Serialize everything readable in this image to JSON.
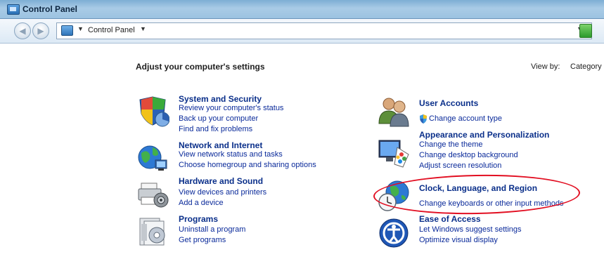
{
  "window": {
    "title": "Control Panel"
  },
  "address_bar": {
    "path_label": "Control Panel"
  },
  "main": {
    "heading": "Adjust your computer's settings",
    "view_by_label": "View by:",
    "view_by_value": "Category"
  },
  "categories": {
    "system": {
      "title": "System and Security",
      "links": [
        "Review your computer's status",
        "Back up your computer",
        "Find and fix problems"
      ]
    },
    "network": {
      "title": "Network and Internet",
      "links": [
        "View network status and tasks",
        "Choose homegroup and sharing options"
      ]
    },
    "hardware": {
      "title": "Hardware and Sound",
      "links": [
        "View devices and printers",
        "Add a device"
      ]
    },
    "programs": {
      "title": "Programs",
      "links": [
        "Uninstall a program",
        "Get programs"
      ]
    },
    "users": {
      "title": "User Accounts",
      "links": [
        "Change account type"
      ]
    },
    "appearance": {
      "title": "Appearance and Personalization",
      "links": [
        "Change the theme",
        "Change desktop background",
        "Adjust screen resolution"
      ]
    },
    "clock": {
      "title": "Clock, Language, and Region",
      "links": [
        "Change keyboards or other input methods"
      ]
    },
    "ease": {
      "title": "Ease of Access",
      "links": [
        "Let Windows suggest settings",
        "Optimize visual display"
      ]
    }
  },
  "annotation": {
    "color": "#e20f22"
  }
}
